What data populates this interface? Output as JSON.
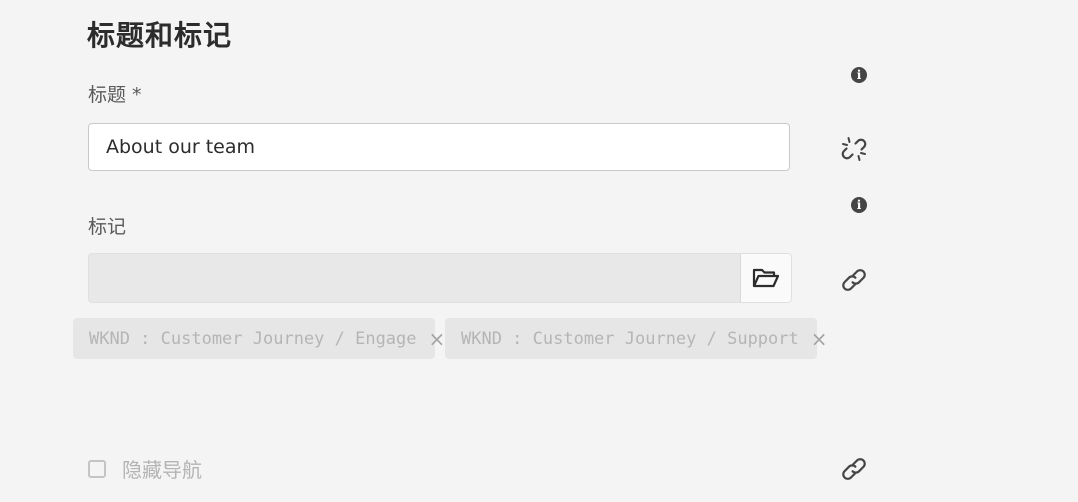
{
  "section": {
    "title": "标题和标记"
  },
  "title_field": {
    "label": "标题 *",
    "value": "About our team"
  },
  "tags_field": {
    "label": "标记",
    "value": "",
    "chips": [
      {
        "label": "WKND : Customer Journey / Engage",
        "remove": "×"
      },
      {
        "label": "WKND : Customer Journey / Support",
        "remove": "×"
      }
    ]
  },
  "hide_navigation": {
    "label": "隐藏导航",
    "checked": false
  },
  "icons": {
    "info": "i",
    "title_side": "broken-link-icon",
    "tags_side": "link-icon",
    "hide_nav_side": "link-icon",
    "browse": "folder-open-icon"
  },
  "colors": {
    "background": "#f4f4f4",
    "icon": "#454545",
    "disabled_text": "#b5b5b5"
  }
}
